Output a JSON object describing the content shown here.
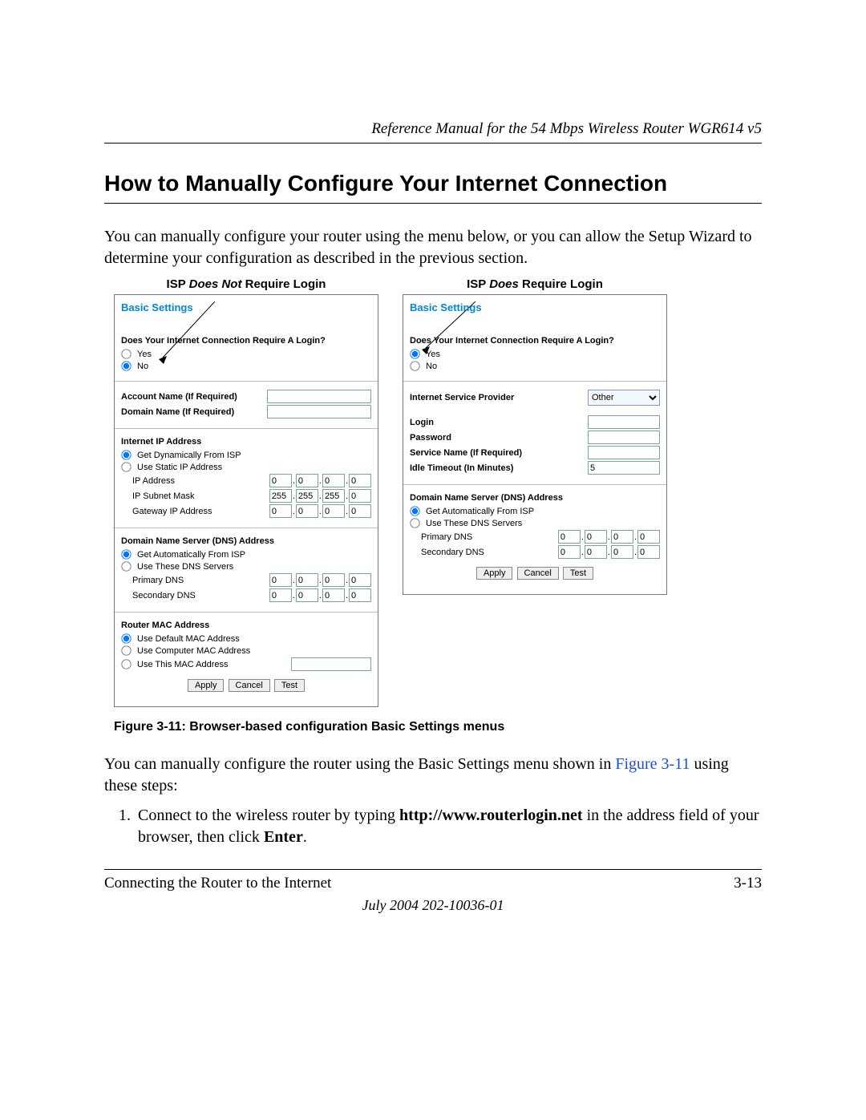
{
  "header": {
    "running": "Reference Manual for the 54 Mbps Wireless Router WGR614 v5"
  },
  "title": "How to Manually Configure Your Internet Connection",
  "intro": "You can manually configure your router using the menu below, or you can allow the Setup Wizard to determine your configuration as described in the previous section.",
  "labels": {
    "isp_not_prefix": "ISP ",
    "isp_not_em": "Does Not",
    "isp_not_suffix": " Require Login",
    "isp_yes_prefix": "ISP ",
    "isp_yes_em": "Does",
    "isp_yes_suffix": " Require Login"
  },
  "leftPanel": {
    "title": "Basic Settings",
    "question": "Does Your Internet Connection Require A Login?",
    "yes": "Yes",
    "no": "No",
    "account_label": "Account Name (If Required)",
    "domain_label": "Domain Name (If Required)",
    "ipheader": "Internet IP Address",
    "ip_dyn": "Get Dynamically From ISP",
    "ip_static": "Use Static IP Address",
    "ip_addr_label": "IP Address",
    "subnet_label": "IP Subnet Mask",
    "gateway_label": "Gateway IP Address",
    "ip": {
      "a": "0",
      "b": "0",
      "c": "0",
      "d": "0"
    },
    "mask": {
      "a": "255",
      "b": "255",
      "c": "255",
      "d": "0"
    },
    "gw": {
      "a": "0",
      "b": "0",
      "c": "0",
      "d": "0"
    },
    "dnsheader": "Domain Name Server (DNS) Address",
    "dns_auto": "Get Automatically From ISP",
    "dns_use": "Use These DNS Servers",
    "primary_dns": "Primary DNS",
    "secondary_dns": "Secondary DNS",
    "pdns": {
      "a": "0",
      "b": "0",
      "c": "0",
      "d": "0"
    },
    "sdns": {
      "a": "0",
      "b": "0",
      "c": "0",
      "d": "0"
    },
    "macheader": "Router MAC Address",
    "mac_default": "Use Default MAC Address",
    "mac_computer": "Use Computer MAC Address",
    "mac_this": "Use This MAC Address",
    "apply": "Apply",
    "cancel": "Cancel",
    "test": "Test"
  },
  "rightPanel": {
    "title": "Basic Settings",
    "question": "Does Your Internet Connection Require A Login?",
    "yes": "Yes",
    "no": "No",
    "isp_label": "Internet Service Provider",
    "isp_value": "Other",
    "login": "Login",
    "password": "Password",
    "service": "Service Name (If Required)",
    "idle": "Idle Timeout (In Minutes)",
    "idle_value": "5",
    "dnsheader": "Domain Name Server (DNS) Address",
    "dns_auto": "Get Automatically From ISP",
    "dns_use": "Use These DNS Servers",
    "primary_dns": "Primary DNS",
    "secondary_dns": "Secondary DNS",
    "pdns": {
      "a": "0",
      "b": "0",
      "c": "0",
      "d": "0"
    },
    "sdns": {
      "a": "0",
      "b": "0",
      "c": "0",
      "d": "0"
    },
    "apply": "Apply",
    "cancel": "Cancel",
    "test": "Test"
  },
  "caption": "Figure 3-11:  Browser-based configuration Basic Settings menus",
  "after1_a": "You can manually configure the router using the Basic Settings menu shown in ",
  "after1_fig": "Figure 3-11",
  "after1_b": " using these steps:",
  "step1_a": "Connect to the wireless router by typing ",
  "step1_url": "http://www.routerlogin.net",
  "step1_b": " in the address field of your browser, then click ",
  "step1_enter": "Enter",
  "step1_c": ".",
  "footer": {
    "left": "Connecting the Router to the Internet",
    "right": "3-13",
    "date": "July 2004 202-10036-01"
  }
}
